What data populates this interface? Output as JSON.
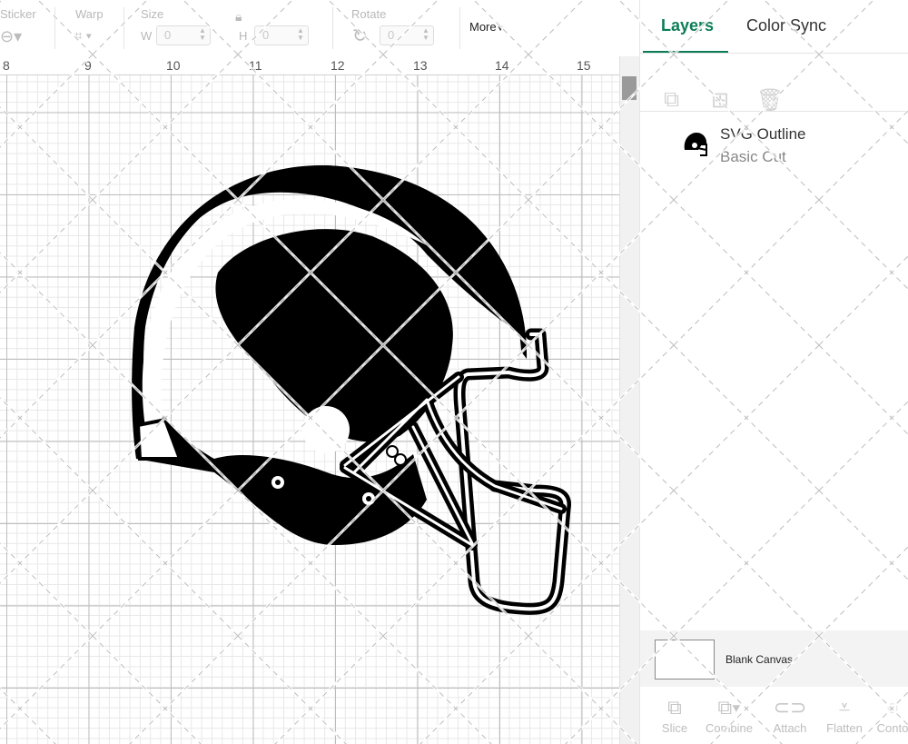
{
  "toolbar": {
    "sticker_label": "Sticker",
    "warp_label": "Warp",
    "size_label": "Size",
    "w_label": "W",
    "w_value": "0",
    "h_label": "H",
    "h_value": "0",
    "rotate_label": "Rotate",
    "rotate_value": "0",
    "more_label": "More"
  },
  "ruler": {
    "ticks": [
      "8",
      "9",
      "10",
      "11",
      "12",
      "13",
      "14",
      "15"
    ]
  },
  "panel": {
    "tabs": [
      {
        "label": "Layers"
      },
      {
        "label": "Color Sync"
      }
    ],
    "layer": {
      "name": "SVG Outline",
      "operation": "Basic Cut"
    },
    "blank_canvas": "Blank Canvas",
    "footer": [
      {
        "label": "Slice"
      },
      {
        "label": "Combine"
      },
      {
        "label": "Attach"
      },
      {
        "label": "Flatten"
      },
      {
        "label": "Conto"
      }
    ]
  },
  "colors": {
    "accent": "#0c7d57",
    "shape_fill": "#000000"
  }
}
